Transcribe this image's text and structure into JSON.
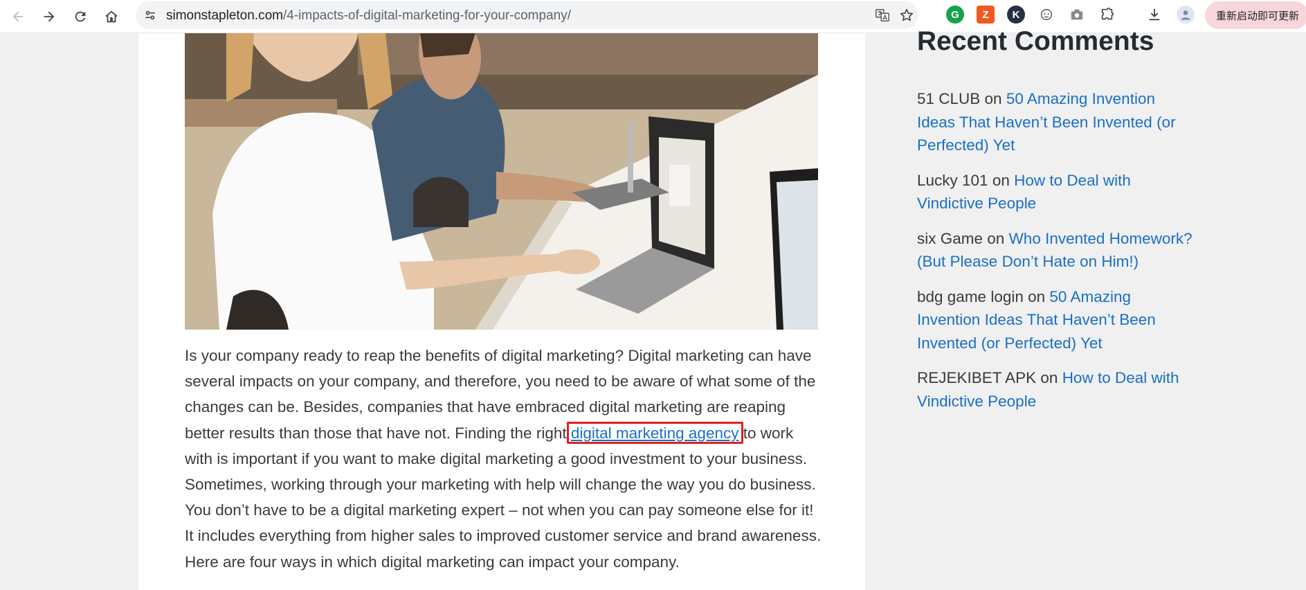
{
  "browser": {
    "url_domain": "simonstapleton.com",
    "url_path": "/4-impacts-of-digital-marketing-for-your-company/",
    "restart_label": "重新启动即可更新"
  },
  "article": {
    "text_before_link": "Is your company ready to reap the benefits of digital marketing? Digital marketing can have several impacts on your company, and therefore, you need to be aware of what some of the changes can be. Besides, companies that have embraced digital marketing are reaping better results than those that have not. Finding the right ",
    "link_text": "digital marketing agency",
    "text_after_link": " to work with is important if you want to make digital marketing a good investment to your business. Sometimes, working through your marketing with help will change the way you do business. You don’t have to be a digital marketing expert – not when you can pay someone else for it! It includes everything from higher sales to improved customer service and brand awareness. Here are four ways in which digital marketing can impact your company."
  },
  "sidebar": {
    "title": "Recent Comments",
    "comments": [
      {
        "author": "51 CLUB",
        "on": " on ",
        "post": "50 Amazing Invention Ideas That Haven’t Been Invented (or Perfected) Yet"
      },
      {
        "author": "Lucky 101",
        "on": " on ",
        "post": "How to Deal with Vindictive People"
      },
      {
        "author": "six Game",
        "on": " on ",
        "post": "Who Invented Homework? (But Please Don’t Hate on Him!)"
      },
      {
        "author": "bdg game login",
        "on": " on ",
        "post": "50 Amazing Invention Ideas That Haven’t Been Invented (or Perfected) Yet"
      },
      {
        "author": "REJEKIBET APK",
        "on": " on ",
        "post": "How to Deal with Vindictive People"
      }
    ]
  },
  "colors": {
    "link": "#1a6fc4",
    "highlight": "#e0201e",
    "body_text": "#3a3a3a"
  }
}
